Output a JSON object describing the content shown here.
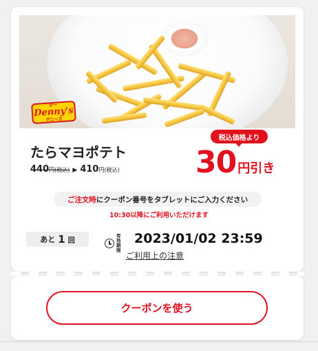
{
  "coupon": {
    "brand_logo_top": "ダー",
    "brand_logo_main": "Denny's",
    "brand_logo_bottom": "デニーズ",
    "product_name": "たらマヨポテト",
    "price_before": "440",
    "price_before_unit": "円(税込)",
    "price_arrow": "▶",
    "price_after": "410",
    "price_after_unit": "円(税込)",
    "badge_text": "税込価格より",
    "discount_amount": "30",
    "discount_unit": "円引き",
    "notice_red": "ご注文時",
    "notice_text": "にクーポン番号をタブレットにご入力ください",
    "time_note": "10:30以降にご利用いただけます",
    "remaining_prefix": "あと",
    "remaining_count": "1",
    "remaining_suffix": "回",
    "deadline_label": "有効期限",
    "deadline": "2023/01/02 23:59",
    "caution_link": "ご利用上の注意",
    "use_button": "クーポンを使う"
  },
  "colors": {
    "accent": "#e3101e",
    "logo_yellow": "#ffd300"
  },
  "icons": {
    "clock": "clock-icon",
    "arrow": "arrow-right-icon"
  }
}
